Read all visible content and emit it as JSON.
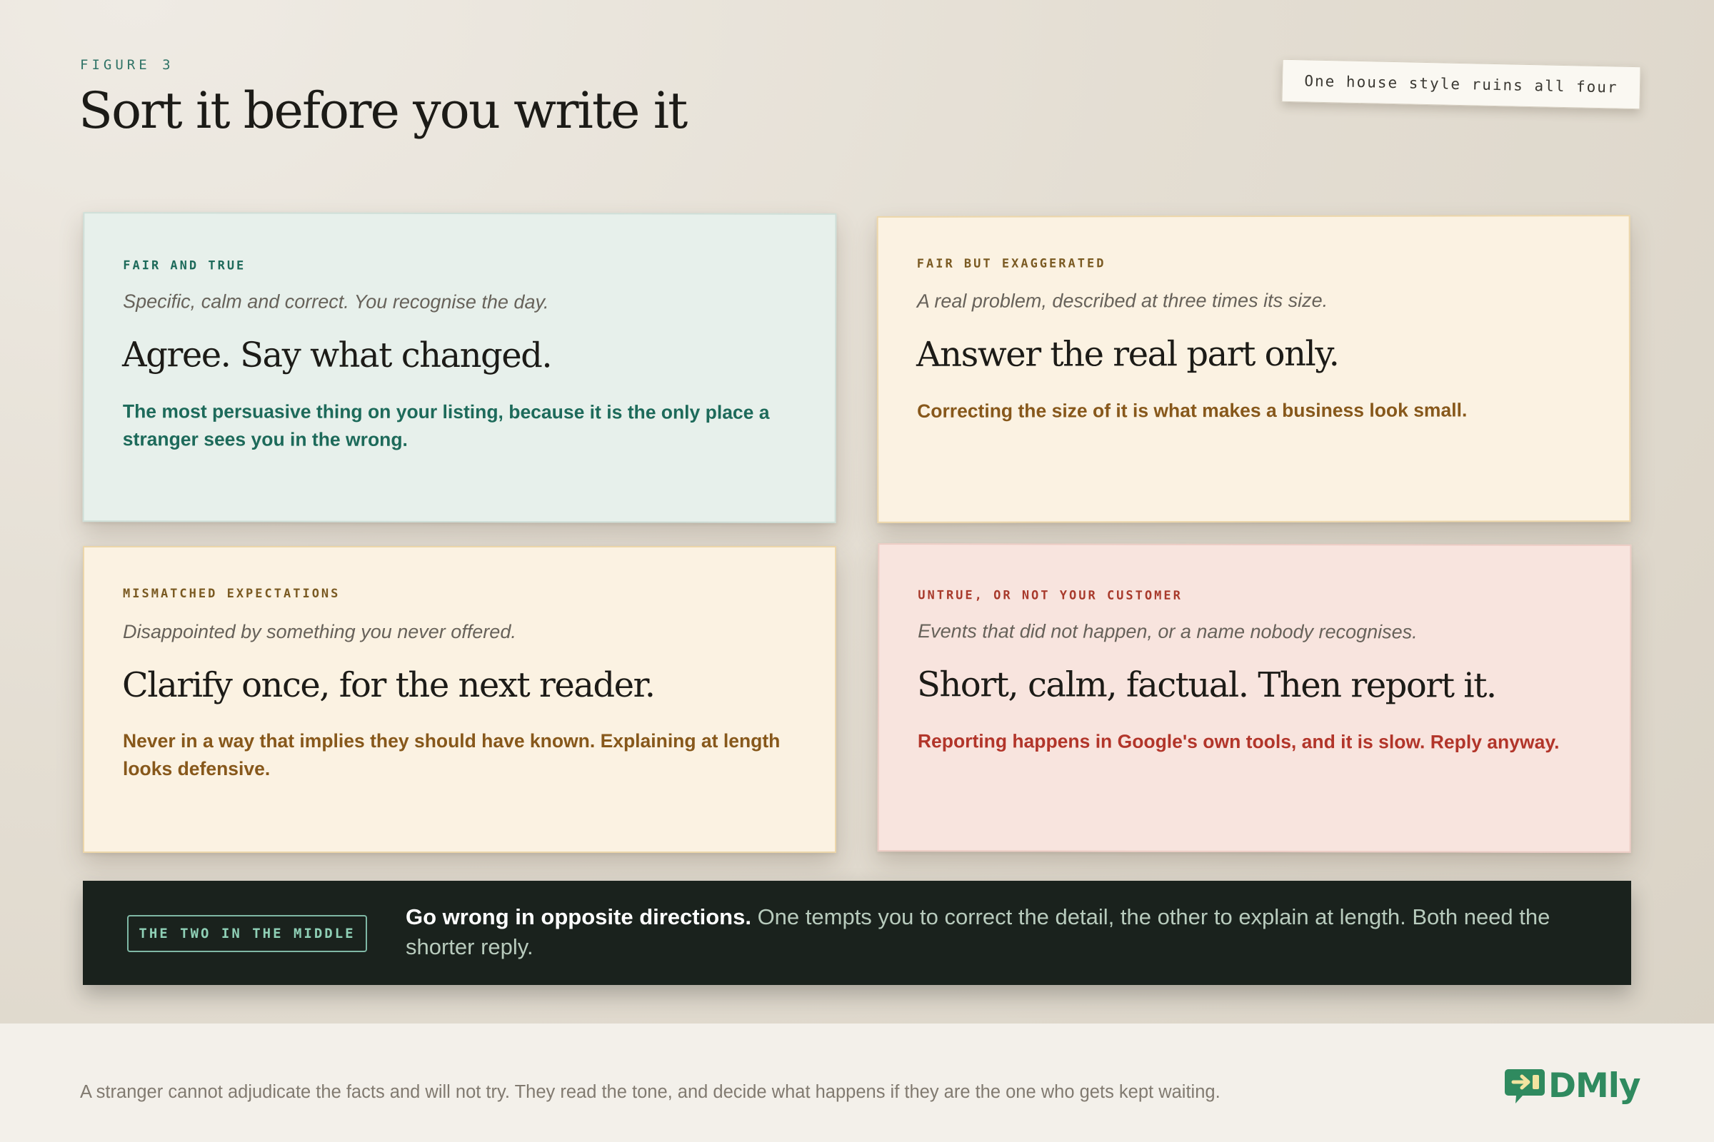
{
  "header": {
    "figure_label": "FIGURE 3",
    "title": "Sort it before you write it",
    "note": "One house style ruins all four"
  },
  "cards": [
    {
      "tag": "FAIR AND TRUE",
      "subtitle": "Specific, calm and correct. You recognise the day.",
      "heading": "Agree. Say what changed.",
      "body": "The most persuasive thing on your listing, because it is the only place a stranger sees you in the wrong.",
      "accent": "#1d6a5a",
      "background": "#e7f0eb"
    },
    {
      "tag": "FAIR BUT EXAGGERATED",
      "subtitle": "A real problem, described at three times its size.",
      "heading": "Answer the real part only.",
      "body": "Correcting the size of it is what makes a business look small.",
      "accent": "#87581b",
      "background": "#fbf2e2"
    },
    {
      "tag": "MISMATCHED EXPECTATIONS",
      "subtitle": "Disappointed by something you never offered.",
      "heading": "Clarify once, for the next reader.",
      "body": "Never in a way that implies they should have known. Explaining at length looks defensive.",
      "accent": "#87581b",
      "background": "#fbf2e2"
    },
    {
      "tag": "UNTRUE, OR NOT YOUR CUSTOMER",
      "subtitle": "Events that did not happen, or a name nobody recognises.",
      "heading": "Short, calm, factual. Then report it.",
      "body": "Reporting happens in Google's own tools, and it is slow. Reply anyway.",
      "accent": "#b2352a",
      "background": "#f8e4de"
    }
  ],
  "callout": {
    "badge": "THE TWO IN THE MIDDLE",
    "lead": "Go wrong in opposite directions.",
    "text": " One tempts you to correct the detail, the other to explain at length. Both need the shorter reply."
  },
  "footer": {
    "caption": "A stranger cannot adjudicate the facts and will not try. They read the tone, and decide what happens if they are the one who gets kept waiting.",
    "logo_text": "DMly",
    "logo_icon": "chat-arrow-icon"
  },
  "colors": {
    "brand": "#2f8a5f",
    "callout_bg": "#1a221d",
    "page_bg": "#e3ddd2"
  }
}
